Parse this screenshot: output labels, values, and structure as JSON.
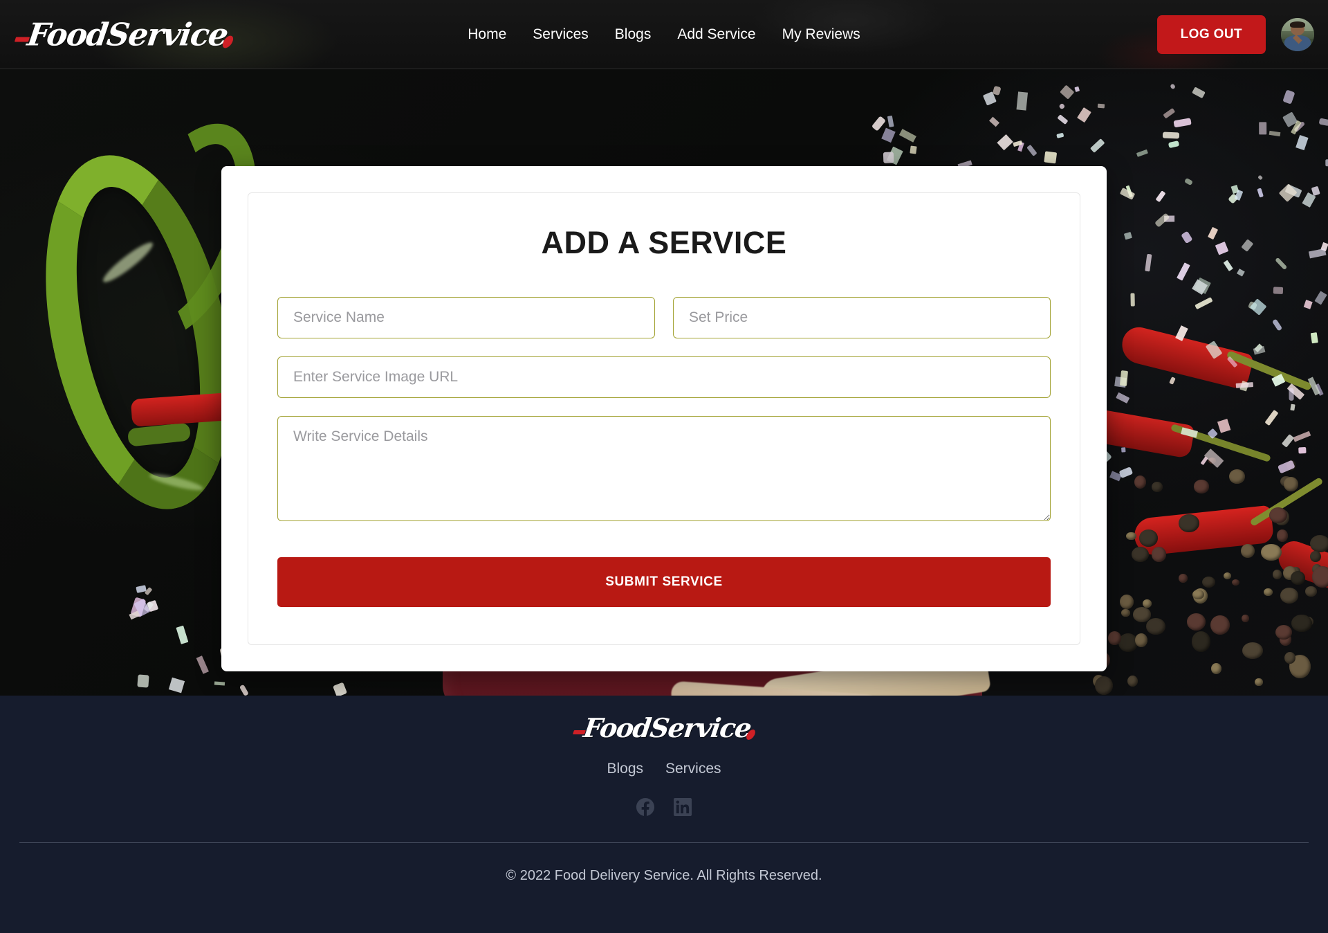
{
  "brand": {
    "name": "FoodService",
    "accent_red": "#cf2026"
  },
  "header": {
    "nav": [
      {
        "label": "Home"
      },
      {
        "label": "Services"
      },
      {
        "label": "Blogs"
      },
      {
        "label": "Add Service"
      },
      {
        "label": "My Reviews"
      }
    ],
    "logout_label": "LOG OUT",
    "avatar_alt": "user-avatar"
  },
  "form": {
    "title": "ADD A SERVICE",
    "service_name": {
      "placeholder": "Service Name",
      "value": ""
    },
    "price": {
      "placeholder": "Set Price",
      "value": ""
    },
    "image_url": {
      "placeholder": "Enter Service Image URL",
      "value": ""
    },
    "details": {
      "placeholder": "Write Service Details",
      "value": ""
    },
    "submit_label": "SUBMIT SERVICE",
    "border_color": "#a3a334",
    "submit_color": "#b81913"
  },
  "footer": {
    "brand": "FoodService",
    "links": [
      {
        "label": "Blogs"
      },
      {
        "label": "Services"
      }
    ],
    "socials": [
      {
        "name": "facebook-icon"
      },
      {
        "name": "linkedin-icon"
      }
    ],
    "copyright": "© 2022 Food Delivery Service. All Rights Reserved.",
    "background": "#161c2d"
  }
}
